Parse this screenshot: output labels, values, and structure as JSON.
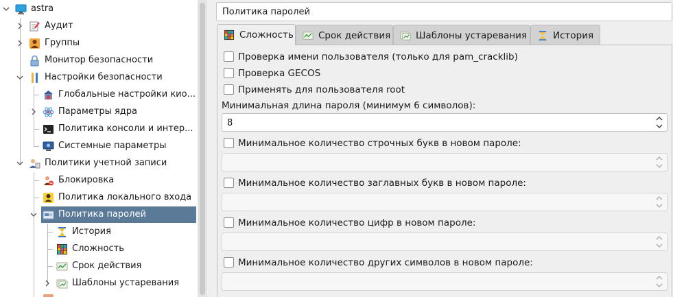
{
  "tree": {
    "root_label": "astra",
    "items": [
      {
        "label": "Аудит"
      },
      {
        "label": "Группы"
      },
      {
        "label": "Монитор безопасности"
      },
      {
        "label": "Настройки безопасности"
      },
      {
        "label": "Глобальные настройки кио..."
      },
      {
        "label": "Параметры ядра"
      },
      {
        "label": "Политика консоли и интер..."
      },
      {
        "label": "Системные параметры"
      },
      {
        "label": "Политики учетной записи"
      },
      {
        "label": "Блокировка"
      },
      {
        "label": "Политика локального входа"
      },
      {
        "label": "Политика паролей"
      },
      {
        "label": "История"
      },
      {
        "label": "Сложность"
      },
      {
        "label": "Срок действия"
      },
      {
        "label": "Шаблоны устаревания"
      }
    ],
    "selected": "Политика паролей"
  },
  "header": {
    "title": "Политика паролей"
  },
  "tabs": [
    {
      "label": "Сложность",
      "active": true
    },
    {
      "label": "Срок действия",
      "active": false
    },
    {
      "label": "Шаблоны устаревания",
      "active": false
    },
    {
      "label": "История",
      "active": false
    }
  ],
  "complexity": {
    "check_username": {
      "label": "Проверка имени пользователя (только для pam_cracklib)",
      "checked": false
    },
    "check_gecos": {
      "label": "Проверка GECOS",
      "checked": false
    },
    "apply_root": {
      "label": "Применять для пользователя root",
      "checked": false
    },
    "min_length": {
      "label": "Минимальная длина пароля (минимум 6 символов):",
      "value": "8"
    },
    "min_lower": {
      "label": "Минимальное количество строчных букв в новом пароле:",
      "checked": false,
      "value": ""
    },
    "min_upper": {
      "label": "Минимальное количество заглавных букв в новом пароле:",
      "checked": false,
      "value": ""
    },
    "min_digits": {
      "label": "Минимальное количество цифр в новом пароле:",
      "checked": false,
      "value": ""
    },
    "min_other": {
      "label": "Минимальное количество других символов в новом пароле:",
      "checked": false,
      "value": ""
    }
  },
  "colors": {
    "selection": "#5a7a98",
    "tab_active": "#efefef",
    "tab_inactive": "#d2d2d2"
  }
}
